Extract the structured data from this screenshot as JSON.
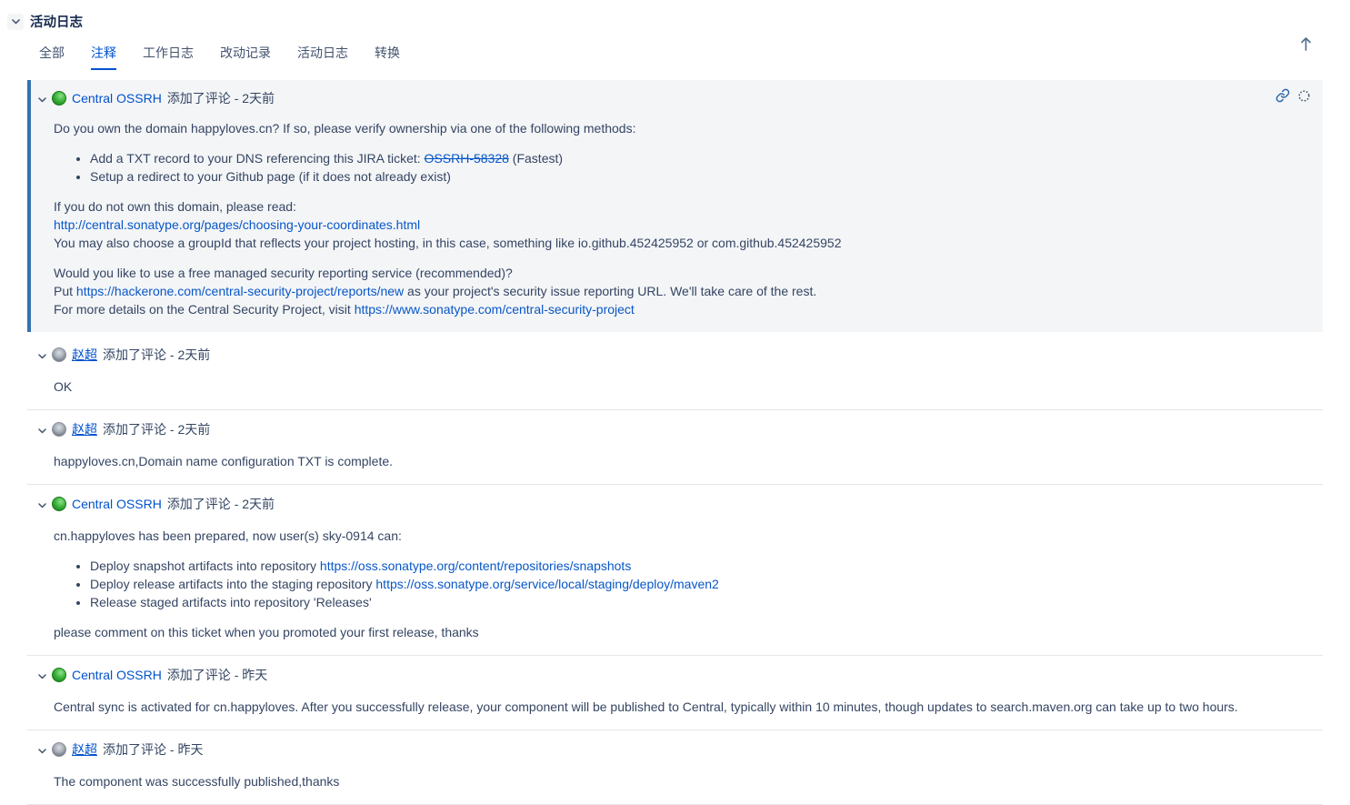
{
  "colors": {
    "accent": "#0052cc",
    "link": "#0757c8",
    "highlight_bg": "#f4f5f7",
    "highlight_border": "#3572b0",
    "text": "#344563",
    "title_text": "#172b4d"
  },
  "section": {
    "title": "活动日志",
    "collapse_icon": "chevron-down-icon"
  },
  "tabs": {
    "items": [
      {
        "name": "all",
        "label": "全部",
        "active": false
      },
      {
        "name": "comments",
        "label": "注释",
        "active": true
      },
      {
        "name": "worklog",
        "label": "工作日志",
        "active": false
      },
      {
        "name": "history",
        "label": "改动记录",
        "active": false
      },
      {
        "name": "activity",
        "label": "活动日志",
        "active": false
      },
      {
        "name": "transitions",
        "label": "转换",
        "active": false
      }
    ]
  },
  "toolbar": {
    "scroll_top_icon": "arrow-up-icon"
  },
  "comments": [
    {
      "author": "Central OSSRH",
      "avatar": "green-sphere",
      "author_underline": false,
      "action": "添加了评论",
      "time": "2天前",
      "highlighted": true,
      "header_icons": [
        {
          "name": "link-icon"
        },
        {
          "name": "dots-circle-icon"
        }
      ],
      "body": [
        {
          "type": "p",
          "segments": [
            {
              "text": "Do you own the domain happyloves.cn? If so, please verify ownership via one of the following methods:"
            }
          ]
        },
        {
          "type": "ul",
          "items": [
            [
              {
                "text": "Add a TXT record to your DNS referencing this JIRA ticket: "
              },
              {
                "text": "OSSRH-58328",
                "link": true,
                "strike": true
              },
              {
                "text": " (Fastest)"
              }
            ],
            [
              {
                "text": "Setup a redirect to your Github page (if it does not already exist)"
              }
            ]
          ]
        },
        {
          "type": "p",
          "segments": [
            {
              "text": "If you do not own this domain, please read:"
            },
            {
              "br": true
            },
            {
              "text": "http://central.sonatype.org/pages/choosing-your-coordinates.html",
              "link": true
            },
            {
              "br": true
            },
            {
              "text": "You may also choose a groupId that reflects your project hosting, in this case, something like io.github.452425952 or com.github.452425952"
            }
          ]
        },
        {
          "type": "p",
          "segments": [
            {
              "text": "Would you like to use a free managed security reporting service (recommended)?"
            },
            {
              "br": true
            },
            {
              "text": "Put "
            },
            {
              "text": "https://hackerone.com/central-security-project/reports/new",
              "link": true
            },
            {
              "text": " as your project's security issue reporting URL. We'll take care of the rest."
            },
            {
              "br": true
            },
            {
              "text": "For more details on the Central Security Project, visit "
            },
            {
              "text": "https://www.sonatype.com/central-security-project",
              "link": true
            }
          ]
        }
      ]
    },
    {
      "author": "赵超",
      "avatar": "photo",
      "author_underline": true,
      "action": "添加了评论",
      "time": "2天前",
      "highlighted": false,
      "body": [
        {
          "type": "p",
          "segments": [
            {
              "text": "OK"
            }
          ]
        }
      ]
    },
    {
      "author": "赵超",
      "avatar": "photo",
      "author_underline": true,
      "action": "添加了评论",
      "time": "2天前",
      "highlighted": false,
      "body": [
        {
          "type": "p",
          "segments": [
            {
              "text": "happyloves.cn,Domain name configuration TXT is complete."
            }
          ]
        }
      ]
    },
    {
      "author": "Central OSSRH",
      "avatar": "green-sphere",
      "author_underline": false,
      "action": "添加了评论",
      "time": "2天前",
      "highlighted": false,
      "body": [
        {
          "type": "p",
          "segments": [
            {
              "text": "cn.happyloves has been prepared, now user(s) sky-0914 can:"
            }
          ]
        },
        {
          "type": "ul",
          "items": [
            [
              {
                "text": "Deploy snapshot artifacts into repository "
              },
              {
                "text": "https://oss.sonatype.org/content/repositories/snapshots",
                "link": true
              }
            ],
            [
              {
                "text": "Deploy release artifacts into the staging repository "
              },
              {
                "text": "https://oss.sonatype.org/service/local/staging/deploy/maven2",
                "link": true
              }
            ],
            [
              {
                "text": "Release staged artifacts into repository 'Releases'"
              }
            ]
          ]
        },
        {
          "type": "p",
          "segments": [
            {
              "text": "please comment on this ticket when you promoted your first release, thanks"
            }
          ]
        }
      ]
    },
    {
      "author": "Central OSSRH",
      "avatar": "green-sphere",
      "author_underline": false,
      "action": "添加了评论",
      "time": "昨天",
      "highlighted": false,
      "body": [
        {
          "type": "p",
          "segments": [
            {
              "text": "Central sync is activated for cn.happyloves. After you successfully release, your component will be published to Central, typically within 10 minutes, though updates to search.maven.org can take up to two hours."
            }
          ]
        }
      ]
    },
    {
      "author": "赵超",
      "avatar": "photo",
      "author_underline": true,
      "action": "添加了评论",
      "time": "昨天",
      "highlighted": false,
      "body": [
        {
          "type": "p",
          "segments": [
            {
              "text": "The component was successfully published,thanks"
            }
          ]
        }
      ]
    }
  ]
}
